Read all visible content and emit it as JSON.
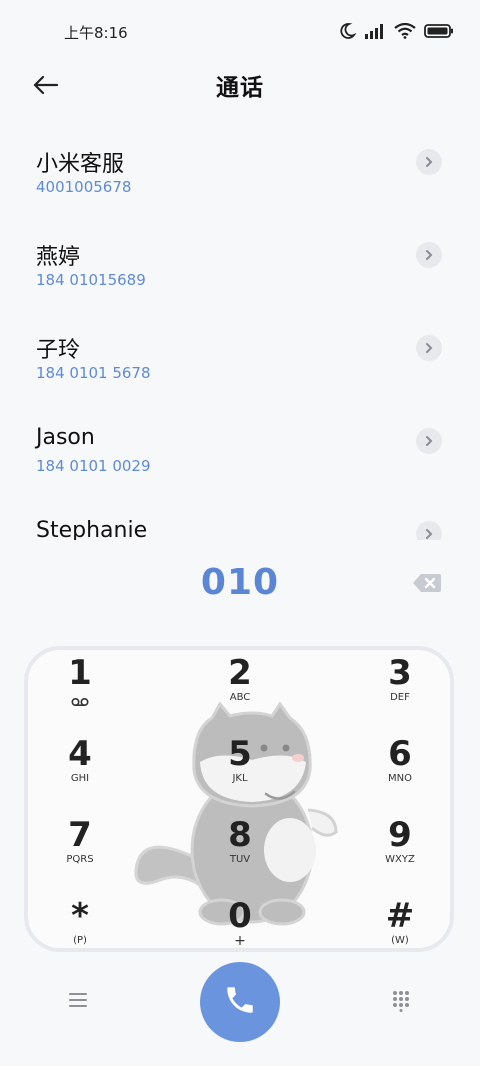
{
  "status_bar": {
    "time": "上午8:16",
    "icons": [
      "moon-icon",
      "signal-icon",
      "wifi-icon",
      "battery-icon"
    ]
  },
  "header": {
    "title": "通话",
    "back_icon": "back-arrow-icon"
  },
  "contacts": [
    {
      "name": "小米客服",
      "number": "4001005678"
    },
    {
      "name": "燕婷",
      "number": "184 01015689"
    },
    {
      "name": "子玲",
      "number": "184 0101 5678"
    },
    {
      "name": "Jason",
      "number": "184 0101 0029"
    },
    {
      "name": "Stephanie",
      "number": ""
    }
  ],
  "dialer": {
    "input": "010",
    "backspace_icon": "backspace-icon"
  },
  "keypad": {
    "keys": [
      {
        "digit": "1",
        "letters": "",
        "icon": "voicemail-icon"
      },
      {
        "digit": "2",
        "letters": "ABC"
      },
      {
        "digit": "3",
        "letters": "DEF"
      },
      {
        "digit": "4",
        "letters": "GHI"
      },
      {
        "digit": "5",
        "letters": "JKL"
      },
      {
        "digit": "6",
        "letters": "MNO"
      },
      {
        "digit": "7",
        "letters": "PQRS"
      },
      {
        "digit": "8",
        "letters": "TUV"
      },
      {
        "digit": "9",
        "letters": "WXYZ"
      },
      {
        "digit": "*",
        "letters": "(P)"
      },
      {
        "digit": "0",
        "letters": "+"
      },
      {
        "digit": "#",
        "letters": "(W)"
      }
    ]
  },
  "bottom": {
    "menu_icon": "menu-icon",
    "call_icon": "phone-icon",
    "keypad_icon": "dialpad-icon"
  },
  "colors": {
    "accent": "#5b86d6",
    "call_button": "#6b94df",
    "number_text": "#5f8bd6"
  }
}
